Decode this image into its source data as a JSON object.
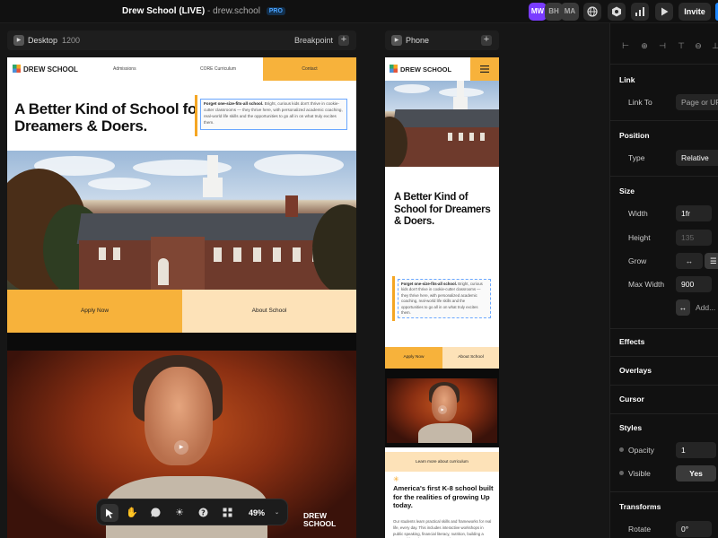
{
  "topbar": {
    "project_name": "Drew School (LIVE)",
    "separator": "-",
    "domain": "drew.school",
    "plan_badge": "PRO",
    "avatars": [
      {
        "initials": "MW",
        "color": "#7a3cff"
      },
      {
        "initials": "BH",
        "color": "#3a3a3a"
      },
      {
        "initials": "MA",
        "color": "#3a3a3a"
      }
    ],
    "invite_label": "Invite"
  },
  "desktop_frame": {
    "name": "Desktop",
    "width": "1200",
    "breakpoint_label": "Breakpoint",
    "nav": {
      "logo": "DREW SCHOOL",
      "links": [
        "Admissions",
        "CORE Curriculum"
      ],
      "contact": "Contact"
    },
    "hero_title_line1": "A Better Kind of School for",
    "hero_title_line2": "Dreamers & Doers.",
    "quote_bold": "Forget one-size-fits-all school.",
    "quote_text": "Bright, curious kids don't thrive in cookie-cutter classrooms — they thrive here, with personalized academic coaching, real-world life skills and the opportunities to go all in on what truly excites them.",
    "cta_primary": "Apply Now",
    "cta_secondary": "About School",
    "video_watermark_line1": "DREW",
    "video_watermark_line2": "SCHOOL"
  },
  "phone_frame": {
    "name": "Phone",
    "nav_logo": "DREW SCHOOL",
    "hero_title": "A Better Kind of School for Dreamers & Doers.",
    "quote_bold": "Forget one-size-fits-all school.",
    "quote_text": "Bright, curious kids don't thrive in cookie-cutter classrooms — they thrive here, with personalized academic coaching, real-world life skills and the opportunities to go all in on what truly excites them.",
    "cta_primary": "Apply Now",
    "cta_secondary": "About School",
    "curriculum_link": "Learn more about curriculum",
    "section_title": "America's first K-8 school built for the realities of growing Up today.",
    "section_body": "Our students learn practical skills and frameworks for real life, every day. This includes interactive workshops in public speaking, financial literacy, nutrition, building a personal brand, AI competence, time management, resilience, personal fitness, habit-building, screen time control and more."
  },
  "toolbar": {
    "tools": [
      "select-tool",
      "hand-tool",
      "comment-tool",
      "theme-tool",
      "help-tool",
      "grid-tool"
    ],
    "zoom": "49%"
  },
  "panel": {
    "link": {
      "section": "Link",
      "link_to_label": "Link To",
      "link_to_value": "Page or URL"
    },
    "position": {
      "section": "Position",
      "type_label": "Type",
      "type_value": "Relative"
    },
    "size": {
      "section": "Size",
      "width_label": "Width",
      "width_value": "1fr",
      "height_label": "Height",
      "height_value": "135",
      "grow_label": "Grow",
      "max_width_label": "Max Width",
      "max_width_value": "900",
      "add_label": "Add..."
    },
    "effects": "Effects",
    "overlays": "Overlays",
    "cursor": "Cursor",
    "styles": {
      "section": "Styles",
      "opacity_label": "Opacity",
      "opacity_value": "1",
      "visible_label": "Visible",
      "visible_value": "Yes"
    },
    "transforms": {
      "section": "Transforms",
      "rotate_label": "Rotate",
      "rotate_value": "0°"
    }
  },
  "colors": {
    "accent_orange": "#f7b23b",
    "cream": "#fde2b8",
    "brand_purple": "#7a3cff",
    "selection_blue": "#6aa7ff"
  }
}
